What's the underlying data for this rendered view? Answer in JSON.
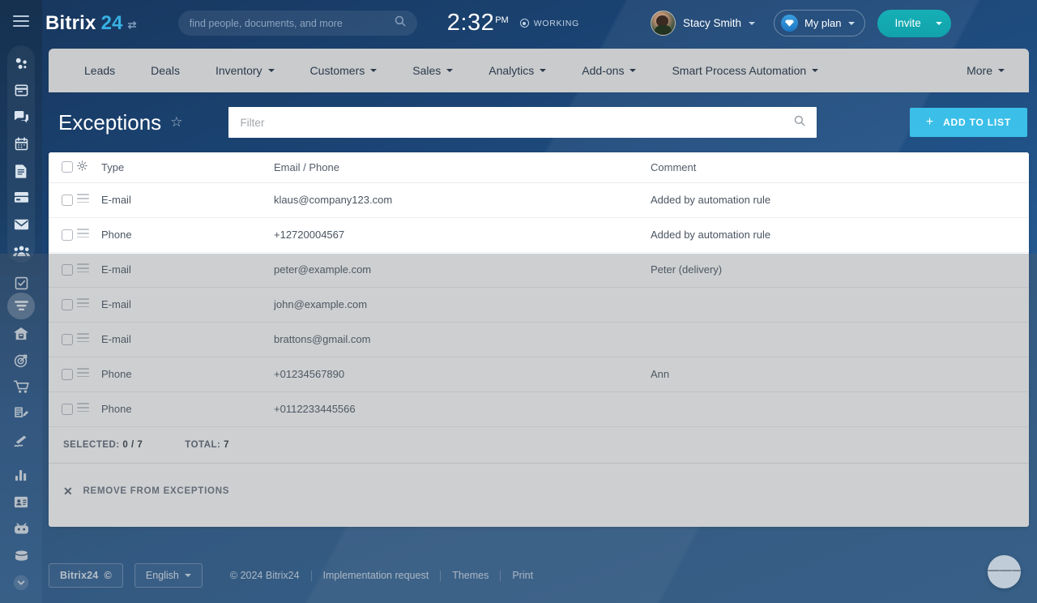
{
  "header": {
    "menu_icon": "hamburger-icon",
    "brand_name": "Bitrix",
    "brand_number": "24",
    "brand_swap_icon": "swap-icon",
    "search": {
      "placeholder": "find people, documents, and more",
      "value": "",
      "icon": "search-icon"
    },
    "clock": {
      "time": "2:32",
      "ampm": "PM"
    },
    "status": {
      "label": "WORKING",
      "icon": "record-icon"
    },
    "user": {
      "name": "Stacy Smith",
      "avatar": "user-avatar",
      "caret": "chevron-down-icon"
    },
    "my_plan": {
      "label": "My plan",
      "icon": "gem-icon",
      "caret": "chevron-down-icon"
    },
    "invite": {
      "label": "Invite",
      "caret": "chevron-down-icon"
    }
  },
  "sidebar": {
    "top_icons": [
      {
        "name": "company-pulse-icon"
      },
      {
        "name": "feed-icon"
      },
      {
        "name": "chat-icon"
      },
      {
        "name": "calendar-icon"
      },
      {
        "name": "documents-icon"
      },
      {
        "name": "drive-icon"
      },
      {
        "name": "mail-icon"
      },
      {
        "name": "group-icon"
      }
    ],
    "bottom_icons": [
      {
        "name": "tasks-icon"
      },
      {
        "name": "crm-funnel-icon",
        "active": true
      },
      {
        "name": "company-icon"
      },
      {
        "name": "marketing-target-icon"
      },
      {
        "name": "online-store-icon"
      },
      {
        "name": "sites-icon"
      },
      {
        "name": "signing-icon"
      },
      {
        "name": "analytics-bar-icon"
      },
      {
        "name": "contact-card-icon"
      },
      {
        "name": "automation-bot-icon"
      },
      {
        "name": "market-icon"
      },
      {
        "name": "more-chevron-icon"
      }
    ]
  },
  "nav": {
    "items": [
      {
        "label": "Leads",
        "dropdown": false
      },
      {
        "label": "Deals",
        "dropdown": false
      },
      {
        "label": "Inventory",
        "dropdown": true
      },
      {
        "label": "Customers",
        "dropdown": true
      },
      {
        "label": "Sales",
        "dropdown": true
      },
      {
        "label": "Analytics",
        "dropdown": true
      },
      {
        "label": "Add-ons",
        "dropdown": true
      },
      {
        "label": "Smart Process Automation",
        "dropdown": true
      }
    ],
    "more": {
      "label": "More",
      "dropdown": true
    }
  },
  "page": {
    "title": "Exceptions",
    "favorite_icon": "star-icon",
    "filter": {
      "placeholder": "Filter",
      "value": "",
      "icon": "search-icon"
    },
    "add_button": {
      "label": "ADD TO LIST",
      "icon": "plus-icon"
    }
  },
  "table": {
    "select_all_checkbox": "select-all-checkbox",
    "settings_icon": "gear-icon",
    "columns": [
      "Type",
      "Email / Phone",
      "Comment"
    ],
    "rows": [
      {
        "type": "E-mail",
        "value": "klaus@company123.com",
        "comment": "Added by automation rule"
      },
      {
        "type": "Phone",
        "value": "+12720004567",
        "comment": "Added by automation rule"
      },
      {
        "type": "E-mail",
        "value": "peter@example.com",
        "comment": "Peter (delivery)"
      },
      {
        "type": "E-mail",
        "value": "john@example.com",
        "comment": ""
      },
      {
        "type": "E-mail",
        "value": "brattons@gmail.com",
        "comment": ""
      },
      {
        "type": "Phone",
        "value": "+01234567890",
        "comment": "Ann"
      },
      {
        "type": "Phone",
        "value": "+0112233445566",
        "comment": ""
      }
    ]
  },
  "totals": {
    "selected_label": "SELECTED:",
    "selected_value": "0 / 7",
    "total_label": "TOTAL:",
    "total_value": "7"
  },
  "actions": {
    "remove_label": "REMOVE FROM EXCEPTIONS",
    "remove_icon": "close-x-icon"
  },
  "footer": {
    "logo_label": "Bitrix24",
    "logo_mark": "©",
    "language": {
      "label": "English",
      "caret": "chevron-down-icon"
    },
    "copyright": "© 2024 Bitrix24",
    "links": [
      "Implementation request",
      "Themes",
      "Print"
    ]
  },
  "fab": {
    "name": "support-lines-button"
  },
  "colors": {
    "accent_blue": "#3bbfe8",
    "brand_number_blue": "#38b0e3",
    "invite_teal": "#16b0b6",
    "nav_gray": "#c9cbcd",
    "panel_white": "#ffffff"
  }
}
